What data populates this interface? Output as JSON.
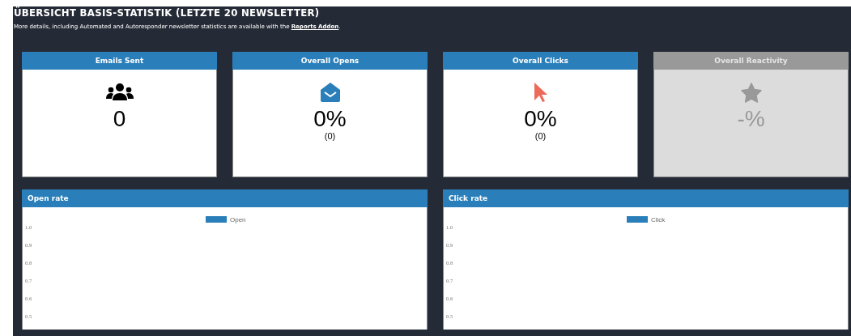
{
  "title": "ÜBERSICHT BASIS-STATISTIK (LETZTE 20 NEWSLETTER)",
  "note": {
    "text": "More details, including Automated and Autoresponder newsletter statistics are available with the ",
    "link": "Reports Addon",
    "after": "."
  },
  "cards": [
    {
      "label": "Emails Sent",
      "kind": "people",
      "value": "0",
      "disabled": false
    },
    {
      "label": "Overall Opens",
      "kind": "envelope",
      "value": "0%",
      "sub": "(0)",
      "disabled": false
    },
    {
      "label": "Overall Clicks",
      "kind": "cursor",
      "value": "0%",
      "sub": "(0)",
      "disabled": false
    },
    {
      "label": "Overall Reactivity",
      "kind": "star",
      "value": "-%",
      "disabled": true
    }
  ],
  "charts": [
    {
      "title": "Open rate",
      "legend": [
        {
          "name": "Open",
          "color": "#2a7fba"
        }
      ],
      "y_labels": [
        "1.0",
        "0.9",
        "0.8",
        "0.7",
        "0.6",
        "0.5"
      ]
    },
    {
      "title": "Click rate",
      "legend": [
        {
          "name": "Click",
          "color": "#2a7fba"
        }
      ],
      "y_labels": [
        "1.0",
        "0.9",
        "0.8",
        "0.7",
        "0.6",
        "0.5"
      ]
    }
  ]
}
